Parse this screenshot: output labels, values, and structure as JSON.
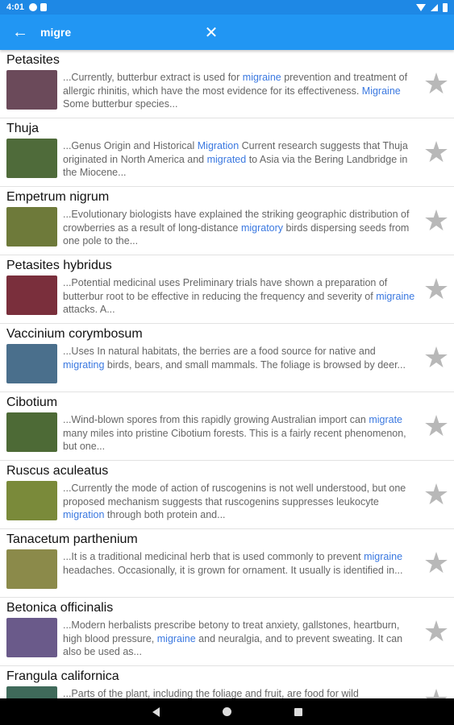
{
  "status": {
    "time": "4:01"
  },
  "search": {
    "query": "migre",
    "back_icon": "arrow-left-icon",
    "clear_icon": "close-icon"
  },
  "results": [
    {
      "title": "Petasites",
      "thumb_color": "#6b4a5a",
      "snippet": [
        {
          "t": "...Currently, butterbur extract is used for "
        },
        {
          "t": "migraine",
          "hl": true
        },
        {
          "t": " prevention and treatment of allergic rhinitis, which have the most evidence for its effectiveness. "
        },
        {
          "t": "Migraine",
          "hl": true
        },
        {
          "t": " Some butterbur species..."
        }
      ]
    },
    {
      "title": "Thuja",
      "thumb_color": "#4f6b3a",
      "snippet": [
        {
          "t": "...Genus Origin and Historical "
        },
        {
          "t": "Migration",
          "hl": true
        },
        {
          "t": " Current research suggests that Thuja originated in North America and "
        },
        {
          "t": "migrated",
          "hl": true
        },
        {
          "t": " to Asia via the Bering Landbridge in the Miocene..."
        }
      ]
    },
    {
      "title": "Empetrum nigrum",
      "thumb_color": "#6e7a3a",
      "snippet": [
        {
          "t": "...Evolutionary biologists have explained the striking geographic distribution of crowberries as a result of long-distance "
        },
        {
          "t": "migratory",
          "hl": true
        },
        {
          "t": " birds dispersing seeds from one pole to the..."
        }
      ]
    },
    {
      "title": "Petasites hybridus",
      "thumb_color": "#7a2f3c",
      "snippet": [
        {
          "t": "...Potential medicinal uses Preliminary trials have shown a preparation of butterbur root to be effective in reducing the frequency and severity of "
        },
        {
          "t": "migraine",
          "hl": true
        },
        {
          "t": " attacks. A..."
        }
      ]
    },
    {
      "title": "Vaccinium corymbosum",
      "thumb_color": "#4a6f8c",
      "snippet": [
        {
          "t": "...Uses In natural habitats, the berries are a food source for native and "
        },
        {
          "t": "migrating",
          "hl": true
        },
        {
          "t": " birds, bears, and small mammals. The foliage is browsed by deer..."
        }
      ]
    },
    {
      "title": "Cibotium",
      "thumb_color": "#4d6a36",
      "snippet": [
        {
          "t": "...Wind-blown spores from this rapidly growing Australian import can "
        },
        {
          "t": "migrate",
          "hl": true
        },
        {
          "t": " many miles into pristine Cibotium forests. This is a fairly recent phenomenon, but one..."
        }
      ]
    },
    {
      "title": "Ruscus aculeatus",
      "thumb_color": "#7a8a3a",
      "snippet": [
        {
          "t": "...Currently the mode of action of ruscogenins is not well understood, but one proposed mechanism suggests that ruscogenins suppresses leukocyte "
        },
        {
          "t": "migration",
          "hl": true
        },
        {
          "t": " through both protein and..."
        }
      ]
    },
    {
      "title": "Tanacetum parthenium",
      "thumb_color": "#8b8a4a",
      "snippet": [
        {
          "t": "...It is a traditional medicinal herb that is used commonly to prevent "
        },
        {
          "t": "migraine",
          "hl": true
        },
        {
          "t": " headaches. Occasionally, it is grown for ornament. It usually is identified in..."
        }
      ]
    },
    {
      "title": "Betonica officinalis",
      "thumb_color": "#6a5a8a",
      "snippet": [
        {
          "t": "...Modern herbalists prescribe betony to treat anxiety, gallstones, heartburn, high blood pressure, "
        },
        {
          "t": "migraine",
          "hl": true
        },
        {
          "t": " and neuralgia, and to prevent sweating. It can also be used as..."
        }
      ]
    },
    {
      "title": "Frangula californica",
      "thumb_color": "#3f6a5a",
      "snippet": [
        {
          "t": "...Parts of the plant, including the foliage and fruit, are food for wild"
        }
      ]
    }
  ],
  "star_icon": "star-icon"
}
